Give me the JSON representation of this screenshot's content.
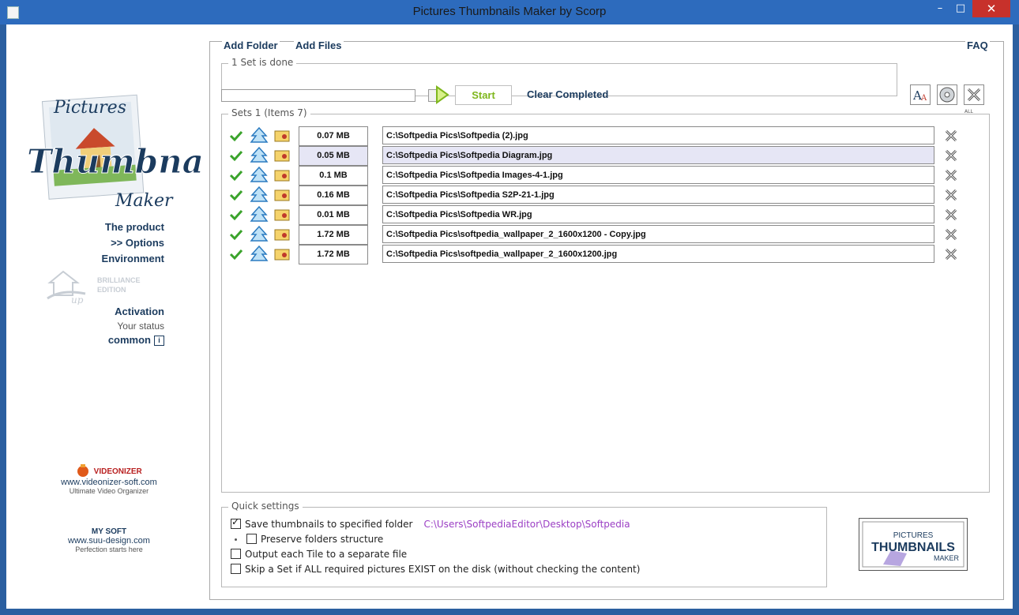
{
  "window": {
    "title": "Pictures Thumbnails Maker by Scorp",
    "minimize": "–",
    "maximize": "□",
    "close": "✕"
  },
  "logo": {
    "line1": "Pictures",
    "line2": "Thumbnails",
    "line3": "Maker"
  },
  "sidebar": {
    "product": "The product",
    "options": ">> Options",
    "environment": "Environment",
    "brilliance_line1": "BRILLIANCE",
    "brilliance_line2": "EDITION",
    "activation": "Activation",
    "status": "Your status",
    "common": "common",
    "info": "i"
  },
  "promos": [
    {
      "brand": "VIDEONIZER",
      "url": "www.videonizer-soft.com",
      "tagline": "Ultimate Video Organizer"
    },
    {
      "brand": "MY SOFT",
      "url": "www.suu-design.com",
      "tagline": "Perfection starts here"
    }
  ],
  "toolbar": {
    "add_folder": "Add Folder",
    "add_files": "Add Files",
    "faq": "FAQ",
    "status_group": "1 Set is done",
    "start": "Start",
    "clear_completed": "Clear Completed",
    "all": "ALL"
  },
  "sets": {
    "label": "Sets 1 (Items 7)",
    "items": [
      {
        "size": "0.07 MB",
        "path": "C:\\Softpedia Pics\\Softpedia (2).jpg",
        "selected": false
      },
      {
        "size": "0.05 MB",
        "path": "C:\\Softpedia Pics\\Softpedia Diagram.jpg",
        "selected": true
      },
      {
        "size": "0.1 MB",
        "path": "C:\\Softpedia Pics\\Softpedia Images-4-1.jpg",
        "selected": false
      },
      {
        "size": "0.16 MB",
        "path": "C:\\Softpedia Pics\\Softpedia S2P-21-1.jpg",
        "selected": false
      },
      {
        "size": "0.01 MB",
        "path": "C:\\Softpedia Pics\\Softpedia WR.jpg",
        "selected": false
      },
      {
        "size": "1.72 MB",
        "path": "C:\\Softpedia Pics\\softpedia_wallpaper_2_1600x1200 - Copy.jpg",
        "selected": false
      },
      {
        "size": "1.72 MB",
        "path": "C:\\Softpedia Pics\\softpedia_wallpaper_2_1600x1200.jpg",
        "selected": false
      }
    ]
  },
  "quick_settings": {
    "label": "Quick settings",
    "save_thumbs": "Save thumbnails to specified folder",
    "save_thumbs_checked": true,
    "save_path": "C:\\Users\\SoftpediaEditor\\Desktop\\Softpedia",
    "preserve": "Preserve folders structure",
    "preserve_checked": false,
    "output_tile": "Output each Tile to a separate file",
    "output_tile_checked": false,
    "skip_set": "Skip a Set if ALL required pictures EXIST on the disk (without checking the content)",
    "skip_set_checked": false
  },
  "badge": {
    "line1": "PICTURES",
    "line2": "THUMBNAILS",
    "line3": "MAKER"
  },
  "colors": {
    "titlebar": "#2d6bbd",
    "link": "#1b3b5e",
    "start": "#7fb71e",
    "path": "#9b3fc4",
    "close": "#c7312b"
  }
}
